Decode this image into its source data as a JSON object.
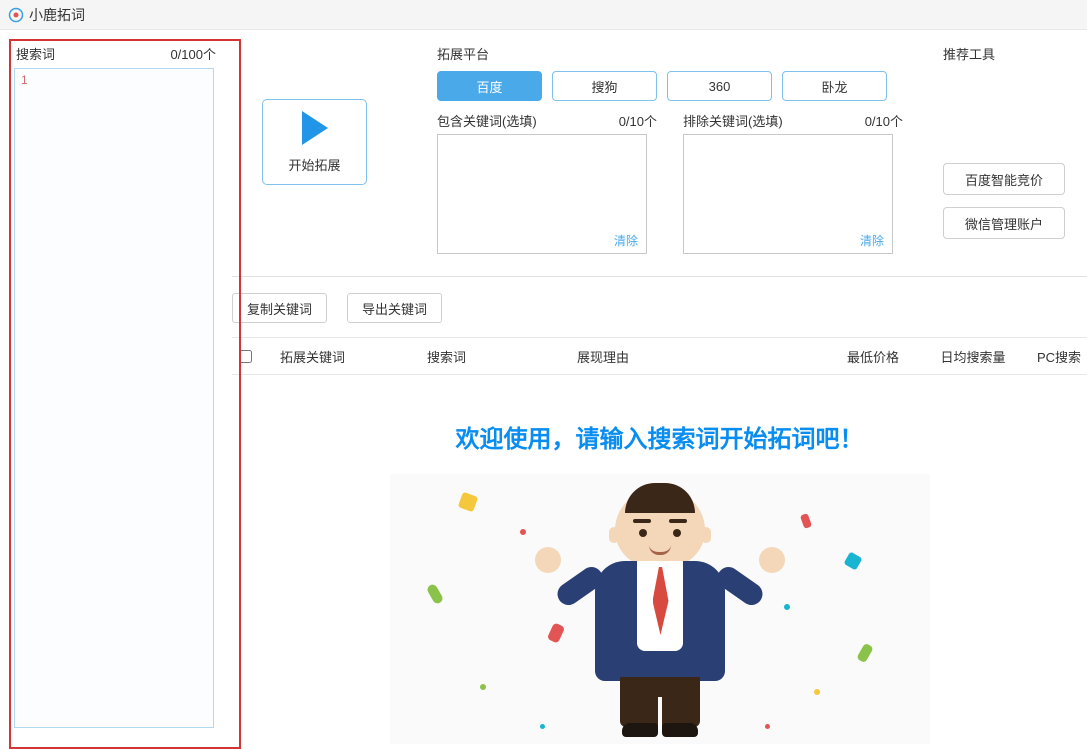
{
  "app": {
    "title": "小鹿拓词"
  },
  "searchPanel": {
    "label": "搜索词",
    "count": "0/100个",
    "lineNo": "1"
  },
  "startBtn": {
    "label": "开始拓展"
  },
  "platforms": {
    "label": "拓展平台",
    "tabs": [
      "百度",
      "搜狗",
      "360",
      "卧龙"
    ]
  },
  "includeKw": {
    "label": "包含关键词(选填)",
    "count": "0/10个",
    "clear": "清除"
  },
  "excludeKw": {
    "label": "排除关键词(选填)",
    "count": "0/10个",
    "clear": "清除"
  },
  "tools": {
    "label": "推荐工具",
    "buttons": [
      "百度智能竞价",
      "微信管理账户"
    ]
  },
  "actions": {
    "copy": "复制关键词",
    "export": "导出关键词"
  },
  "table": {
    "cols": [
      "拓展关键词",
      "搜索词",
      "展现理由",
      "最低价格",
      "日均搜索量",
      "PC搜索"
    ]
  },
  "welcome": {
    "text": "欢迎使用，请输入搜索词开始拓词吧！"
  }
}
